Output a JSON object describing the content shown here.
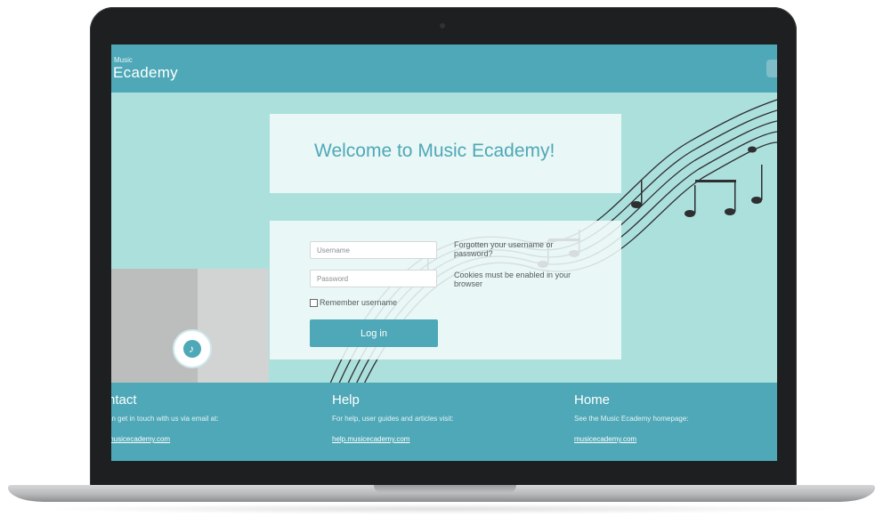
{
  "header": {
    "logo_small": "Music",
    "logo_big": "Ecademy"
  },
  "welcome": {
    "title": "Welcome to Music Ecademy!"
  },
  "login": {
    "username_placeholder": "Username",
    "password_placeholder": "Password",
    "remember_label": "Remember username",
    "login_label": "Log in",
    "forgot_text": "Forgotten your username or password?",
    "cookies_text": "Cookies must be enabled in your browser"
  },
  "footer": {
    "contact": {
      "heading": "ntact",
      "text": "an get in touch with us via email at:",
      "link": "musicecademy.com"
    },
    "help": {
      "heading": "Help",
      "text": "For help, user guides and articles visit:",
      "link": "help.musicecademy.com"
    },
    "home": {
      "heading": "Home",
      "text": "See the Music Ecademy homepage:",
      "link": "musicecademy.com"
    }
  },
  "colors": {
    "brand": "#4ea8b7",
    "background": "#ace0dd"
  },
  "icons": {
    "badge": "music-note-icon"
  }
}
